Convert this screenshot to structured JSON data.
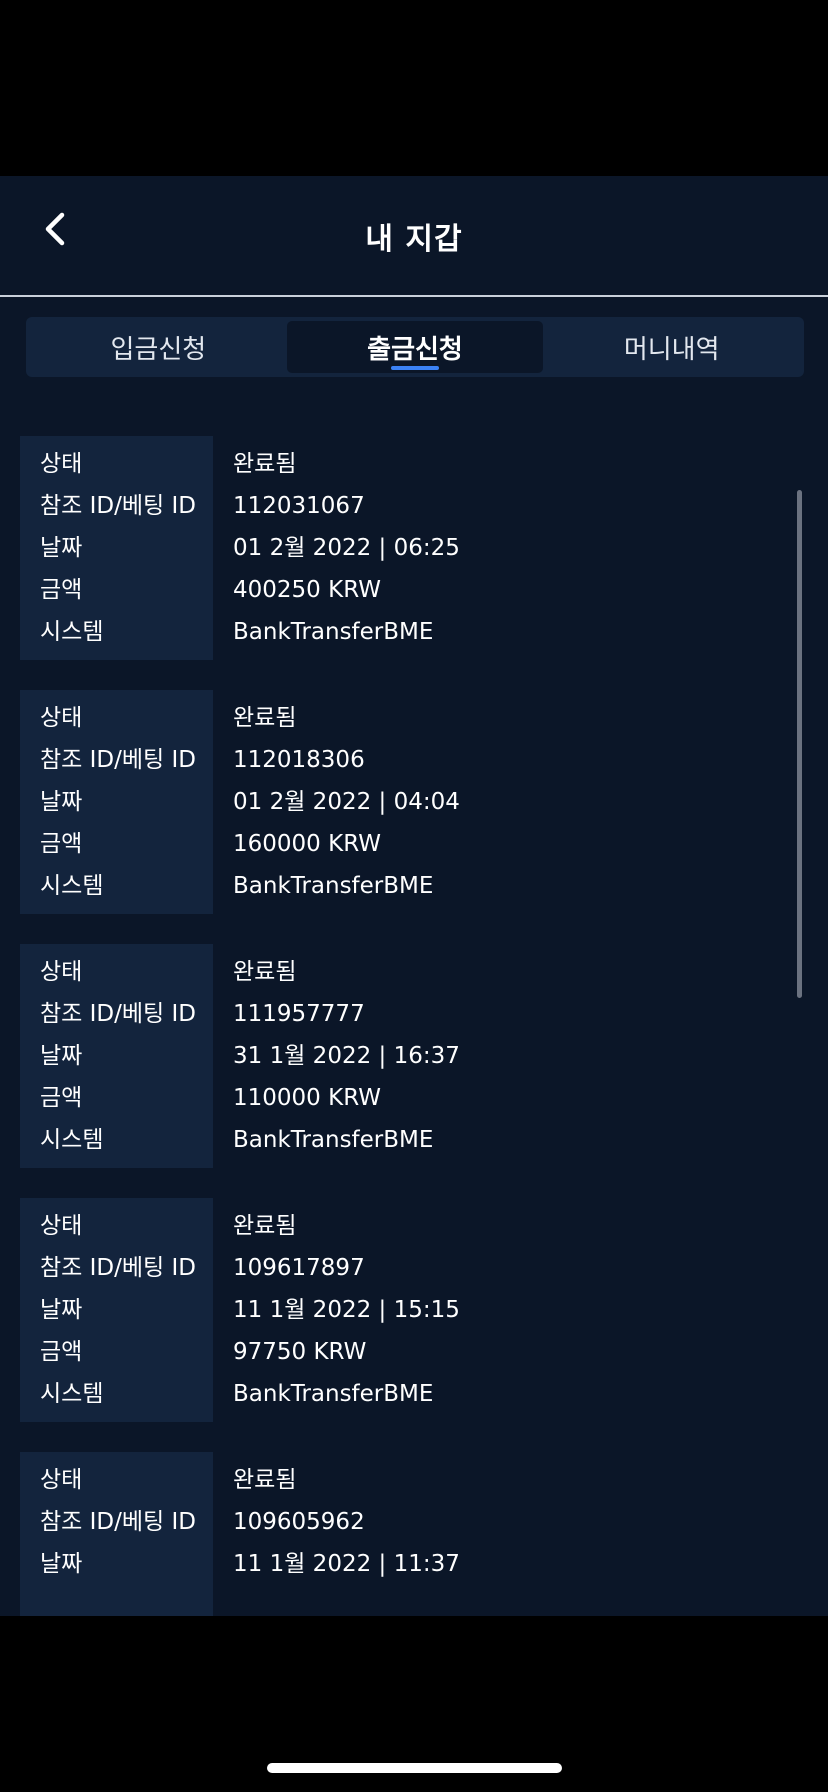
{
  "header": {
    "title": "내 지갑",
    "back_icon": "chevron-left-icon"
  },
  "tabs": [
    {
      "label": "입금신청",
      "active": false
    },
    {
      "label": "출금신청",
      "active": true
    },
    {
      "label": "머니내역",
      "active": false
    }
  ],
  "field_labels": {
    "status": "상태",
    "ref": "참조 ID/베팅 ID",
    "date": "날짜",
    "amount": "금액",
    "system": "시스템"
  },
  "transactions": [
    {
      "status": "완료됨",
      "ref": "112031067",
      "date": "01 2월 2022 | 06:25",
      "amount": "400250 KRW",
      "system": "BankTransferBME"
    },
    {
      "status": "완료됨",
      "ref": "112018306",
      "date": "01 2월 2022 | 04:04",
      "amount": "160000 KRW",
      "system": "BankTransferBME"
    },
    {
      "status": "완료됨",
      "ref": "111957777",
      "date": "31 1월 2022 | 16:37",
      "amount": "110000 KRW",
      "system": "BankTransferBME"
    },
    {
      "status": "완료됨",
      "ref": "109617897",
      "date": "11 1월 2022 | 15:15",
      "amount": "97750 KRW",
      "system": "BankTransferBME"
    },
    {
      "status": "완료됨",
      "ref": "109605962",
      "date": "11 1월 2022 | 11:37"
    }
  ],
  "colors": {
    "background": "#0b1628",
    "panel": "#13243d",
    "accent": "#3b82f6",
    "text": "#ffffff"
  }
}
